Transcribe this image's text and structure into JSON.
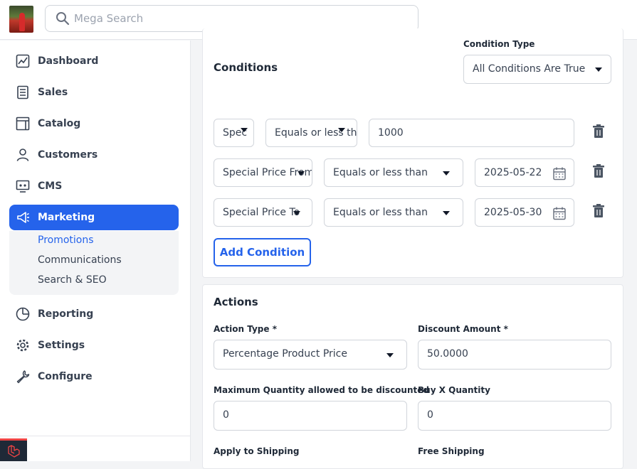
{
  "search": {
    "placeholder": "Mega Search"
  },
  "sidebar": {
    "items": [
      {
        "label": "Dashboard",
        "icon": "dashboard-icon"
      },
      {
        "label": "Sales",
        "icon": "sales-icon"
      },
      {
        "label": "Catalog",
        "icon": "catalog-icon"
      },
      {
        "label": "Customers",
        "icon": "customers-icon"
      },
      {
        "label": "CMS",
        "icon": "cms-icon"
      },
      {
        "label": "Marketing",
        "icon": "marketing-icon"
      },
      {
        "label": "Reporting",
        "icon": "reporting-icon"
      },
      {
        "label": "Settings",
        "icon": "settings-icon"
      },
      {
        "label": "Configure",
        "icon": "configure-icon"
      }
    ],
    "marketing_sub": [
      "Promotions",
      "Communications",
      "Search & SEO"
    ],
    "accent": "#2563eb"
  },
  "conditions": {
    "title": "Conditions",
    "condition_type_label": "Condition Type",
    "condition_type_value": "All Conditions Are True",
    "rows": [
      {
        "attribute": "Spec",
        "operator": "Equals or less th",
        "value": "1000"
      },
      {
        "attribute": "Special Price From",
        "operator": "Equals or less than",
        "value": "2025-05-22"
      },
      {
        "attribute": "Special Price To",
        "operator": "Equals or less than",
        "value": "2025-05-30"
      }
    ],
    "add_label": "Add Condition"
  },
  "actions": {
    "title": "Actions",
    "action_type_label": "Action Type",
    "action_type_value": "Percentage Product Price",
    "discount_label": "Discount Amount",
    "discount_value": "50.0000",
    "max_qty_label": "Maximum Quantity allowed to be discounted",
    "max_qty_value": "0",
    "buy_x_label": "Buy X Quantity",
    "buy_x_value": "0",
    "apply_shipping_label": "Apply to Shipping",
    "free_shipping_label": "Free Shipping",
    "required_mark": "*"
  }
}
